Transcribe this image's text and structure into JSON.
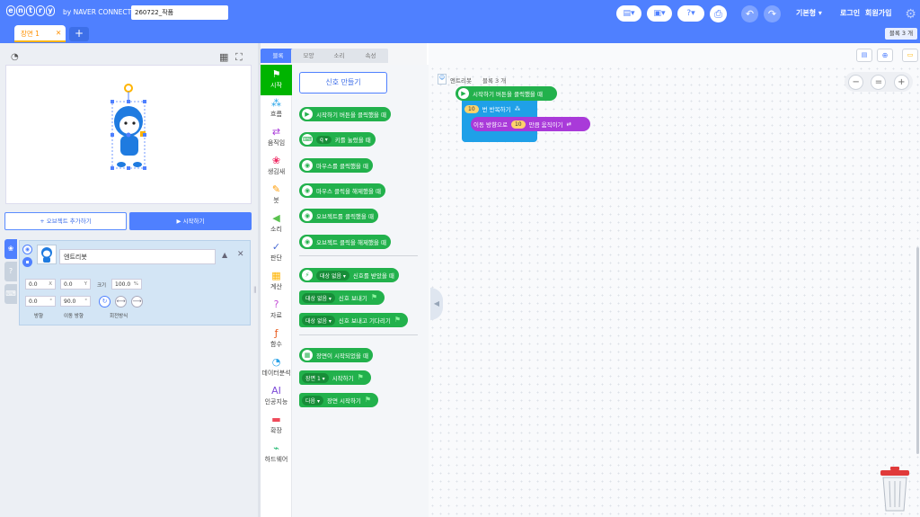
{
  "header": {
    "logo_letters": [
      "e",
      "n",
      "t",
      "r",
      "y"
    ],
    "byline": "by NAVER CONNECT",
    "project_name": "260722_작품",
    "help_label": "?",
    "mode_label": "기본형",
    "login": "로그인",
    "signup": "회원가입"
  },
  "scene": {
    "tab_label": "장면 1",
    "close": "✕",
    "add": "+",
    "block_count": "블록 3 개"
  },
  "stage": {
    "add_object": "+ 오브젝트 추가하기",
    "start": "▶ 시작하기"
  },
  "object": {
    "name": "엔트리봇",
    "x": "0.0",
    "y": "0.0",
    "size": "100.0",
    "direction": "0.0",
    "move_direction": "90.0",
    "x_unit": "X",
    "y_unit": "Y",
    "size_label": "크기",
    "pct": "%",
    "deg": "°",
    "direction_label": "방향",
    "move_direction_label": "이동 방향",
    "rotation_label": "회전방식"
  },
  "block_tabs": [
    "블록",
    "모양",
    "소리",
    "속성"
  ],
  "categories": [
    {
      "label": "시작",
      "icon": "⚑",
      "color": "#00b400"
    },
    {
      "label": "흐름",
      "icon": "⁂",
      "color": "#1fa0e8"
    },
    {
      "label": "움직임",
      "icon": "⇄",
      "color": "#a93ad9"
    },
    {
      "label": "생김새",
      "icon": "❀",
      "color": "#ef2a63"
    },
    {
      "label": "붓",
      "icon": "✎",
      "color": "#ff9b00"
    },
    {
      "label": "소리",
      "icon": "◀",
      "color": "#5ac24f"
    },
    {
      "label": "판단",
      "icon": "✓",
      "color": "#4a6cd4"
    },
    {
      "label": "계산",
      "icon": "▦",
      "color": "#ffb400"
    },
    {
      "label": "자료",
      "icon": "?",
      "color": "#c44fd6"
    },
    {
      "label": "함수",
      "icon": "ƒ",
      "color": "#e8591c"
    },
    {
      "label": "데이터분석",
      "icon": "◔",
      "color": "#2aa3e8"
    },
    {
      "label": "인공지능",
      "icon": "AI",
      "color": "#7d4bd8"
    },
    {
      "label": "확장",
      "icon": "▬",
      "color": "#ef4a5a"
    },
    {
      "label": "하드웨어",
      "icon": "⌁",
      "color": "#1fb86f"
    }
  ],
  "palette": {
    "signal_button": "신호 만들기",
    "blocks": [
      {
        "icon": "▶",
        "text": "시작하기 버튼을 클릭했을 때"
      },
      {
        "icon": "⌨",
        "dd": "q ▾",
        "text": "키를 눌렀을 때"
      },
      {
        "icon": "◉",
        "text": "마우스를 클릭했을 때"
      },
      {
        "icon": "◉",
        "text": "마우스 클릭을 해제했을 때"
      },
      {
        "icon": "◉",
        "text": "오브젝트를 클릭했을 때"
      },
      {
        "icon": "◉",
        "text": "오브젝트 클릭을 해제했을 때"
      }
    ],
    "signal_blocks": [
      {
        "icon": "⚡",
        "dd": "대상 없음 ▾",
        "text": "신호를 받았을 때"
      },
      {
        "dd": "대상 없음 ▾",
        "text": "신호 보내기"
      },
      {
        "dd": "대상 없음 ▾",
        "text": "신호 보내고 기다리기"
      }
    ],
    "scene_blocks": [
      {
        "icon": "▦",
        "text": "장면이 시작되었을 때"
      },
      {
        "dd": "장면 1 ▾",
        "text": "시작하기"
      },
      {
        "dd": "다음 ▾",
        "text": "장면 시작하기"
      }
    ]
  },
  "workspace": {
    "object_label": "엔트리봇",
    "block_count": "블록 3 개",
    "start_block": "시작하기 버튼을 클릭했을 때",
    "repeat_count": "10",
    "repeat_text": "번 반복하기",
    "move_text": "이동 방향으로",
    "move_value": "10",
    "move_suffix": "만큼 움직이기",
    "zoom_out": "−",
    "zoom_reset": "=",
    "zoom_in": "+"
  },
  "colors": {
    "header": "#4f80ff",
    "start_block": "#22b14c",
    "flow_block": "#1fa0e8",
    "move_block": "#a93ad9"
  }
}
